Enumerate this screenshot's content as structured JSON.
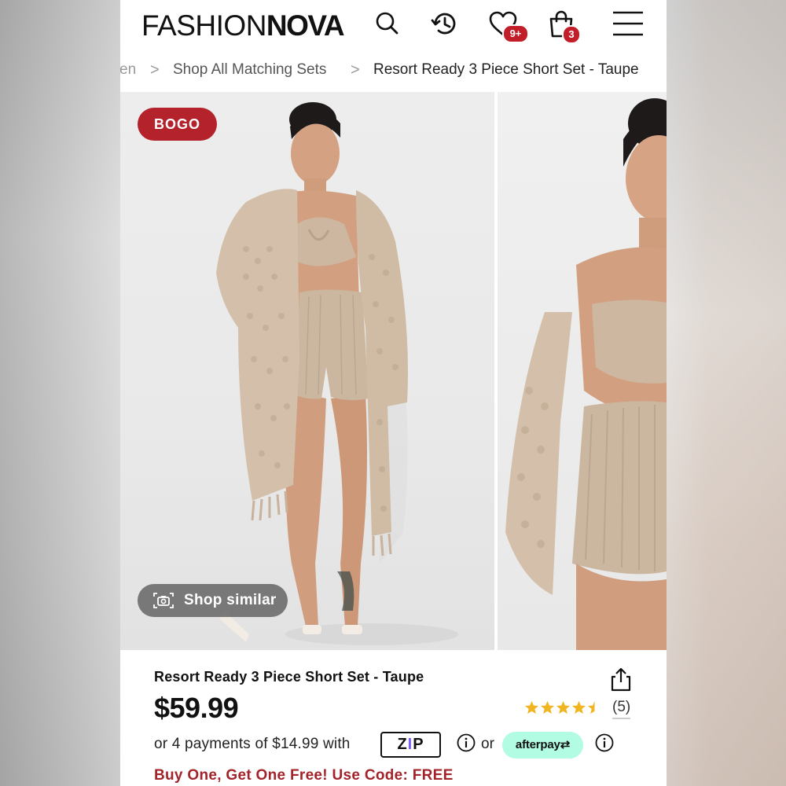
{
  "header": {
    "logo_thin": "FASHION",
    "logo_bold": "NOVA",
    "wishlist_badge": "9+",
    "cart_badge": "3"
  },
  "breadcrumb": {
    "prev": "en",
    "parent": "Shop All Matching Sets",
    "current": "Resort Ready 3 Piece Short Set - Taupe",
    "separator": ">"
  },
  "gallery": {
    "badge": "BOGO",
    "shop_similar": "Shop similar"
  },
  "product": {
    "title": "Resort Ready 3 Piece Short Set - Taupe",
    "price": "$59.99",
    "rating": 4.5,
    "review_count": "(5)",
    "installments_text": "or 4 payments of $14.99 with",
    "zip_label": "ZIP",
    "or_text": "or",
    "afterpay_label": "afterpay",
    "promo": "Buy One, Get One Free! Use Code: FREE"
  },
  "colors": {
    "brand_red": "#b4232c",
    "promo_red": "#a3232b",
    "afterpay_mint": "#b2fce4",
    "star_gold": "#f1b522"
  }
}
